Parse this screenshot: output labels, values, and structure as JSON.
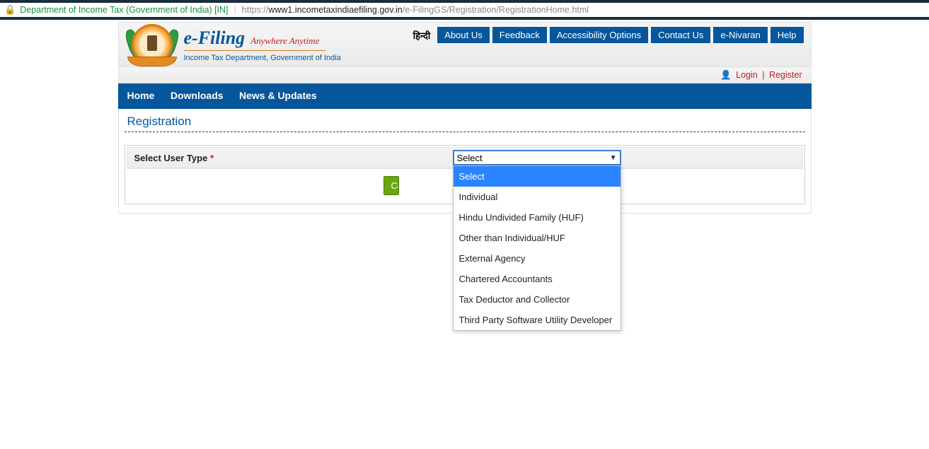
{
  "browser": {
    "pageTitle": "Department of Income Tax (Government of India) [IN]",
    "urlProtocol": "https://",
    "urlHost": "www1.incometaxindiaefiling.gov.in",
    "urlPath": "/e-FilingGS/Registration/RegistrationHome.html"
  },
  "header": {
    "brand_e": "e-",
    "brand_filing": "Filing",
    "tagline": "Anywhere Anytime",
    "subtitle": "Income Tax Department, Government of India",
    "langLink": "हिन्दी",
    "topButtons": [
      "About Us",
      "Feedback",
      "Accessibility Options",
      "Contact Us",
      "e-Nivaran",
      "Help"
    ],
    "login": "Login",
    "register": "Register"
  },
  "nav": [
    "Home",
    "Downloads",
    "News & Updates"
  ],
  "page": {
    "title": "Registration",
    "fieldLabel": "Select User Type",
    "required": "*",
    "selected": "Select",
    "options": [
      "Select",
      "Individual",
      "Hindu Undivided Family (HUF)",
      "Other than Individual/HUF",
      "External Agency",
      "Chartered Accountants",
      "Tax Deductor and Collector",
      "Third Party Software Utility Developer"
    ],
    "continue": "Continue"
  }
}
